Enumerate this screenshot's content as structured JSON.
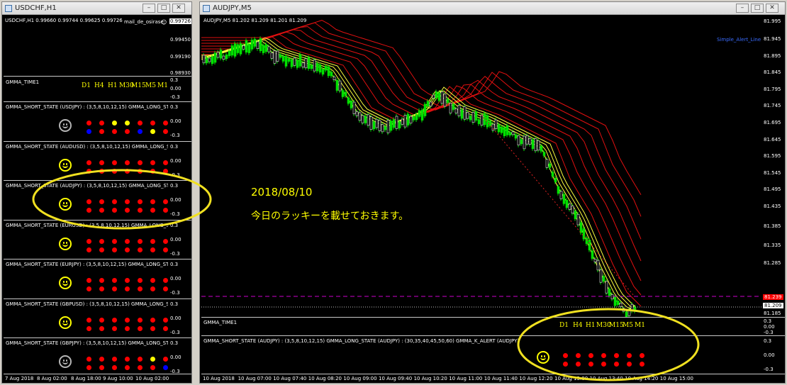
{
  "left_window": {
    "title": "USDCHF,H1",
    "chart_header": "USDCHF,H1  0.99660 0.99744 0.99625 0.99726",
    "indicator_label": "mail_de_osirase",
    "price_ticks": [
      "0.99726",
      "0.99450",
      "0.99190",
      "0.98930"
    ],
    "time_pane": {
      "title": "GMMA_TIME1",
      "frames": [
        "D1",
        "H4",
        "H1",
        "M30",
        "M15",
        "M5",
        "M1"
      ],
      "ticks": [
        "0.3",
        "0.00",
        "-0.3"
      ]
    },
    "state_panes": [
      {
        "title": "GMMA_SHORT_STATE (USDJPY) : (3,5,8,10,12,15)  GMMA_LONG_STA",
        "smiley": "gray",
        "ticks": [
          "0.3",
          "0.00",
          "-0.3"
        ],
        "row1": [
          "#ff0000",
          "#ff0000",
          "#ffff00",
          "#ffff00",
          "#ff0000",
          "#ff0000",
          "#ff0000"
        ],
        "row2": [
          "#0000ff",
          "#ff0000",
          "#ff0000",
          "#ff0000",
          "#0000ff",
          "#ffff00",
          "#ff0000"
        ]
      },
      {
        "title": "GMMA_SHORT_STATE (AUDUSD) : (3,5,8,10,12,15)  GMMA_LONG_STA",
        "smiley": "yellow",
        "ticks": [
          "0.3",
          "0.00",
          "-0.3"
        ],
        "row1": [
          "#ff0000",
          "#ff0000",
          "#ff0000",
          "#ff0000",
          "#ff0000",
          "#ff0000",
          "#ff0000"
        ],
        "row2": [
          "#ff0000",
          "#ff0000",
          "#ff0000",
          "#ff0000",
          "#ff0000",
          "#ff0000",
          "#ff0000"
        ]
      },
      {
        "title": "GMMA_SHORT_STATE (AUDJPY) : (3,5,8,10,12,15)  GMMA_LONG_STA",
        "smiley": "yellow",
        "ticks": [
          "0.3",
          "0.00",
          "-0.3"
        ],
        "row1": [
          "#ff0000",
          "#ff0000",
          "#ff0000",
          "#ff0000",
          "#ff0000",
          "#ff0000",
          "#ff0000"
        ],
        "row2": [
          "#ff0000",
          "#ff0000",
          "#ff0000",
          "#ff0000",
          "#ff0000",
          "#ff0000",
          "#ff0000"
        ]
      },
      {
        "title": "GMMA_SHORT_STATE (EURUSD) : (3,5,8,10,12,15)  GMMA_LONG_STA",
        "smiley": "yellow",
        "ticks": [
          "0.3",
          "0.00",
          "-0.3"
        ],
        "row1": [
          "#ff0000",
          "#ff0000",
          "#ff0000",
          "#ff0000",
          "#ff0000",
          "#ff0000",
          "#ff0000"
        ],
        "row2": [
          "#ff0000",
          "#ff0000",
          "#ff0000",
          "#ff0000",
          "#ff0000",
          "#ff0000",
          "#ff0000"
        ]
      },
      {
        "title": "GMMA_SHORT_STATE (EURJPY) : (3,5,8,10,12,15)  GMMA_LONG_STA",
        "smiley": "yellow",
        "ticks": [
          "0.3",
          "0.00",
          "-0.3"
        ],
        "row1": [
          "#ff0000",
          "#ff0000",
          "#ff0000",
          "#ff0000",
          "#ff0000",
          "#ff0000",
          "#ff0000"
        ],
        "row2": [
          "#ff0000",
          "#ff0000",
          "#ff0000",
          "#ff0000",
          "#ff0000",
          "#ff0000",
          "#ff0000"
        ]
      },
      {
        "title": "GMMA_SHORT_STATE (GBPUSD) : (3,5,8,10,12,15)  GMMA_LONG_STA",
        "smiley": "yellow",
        "ticks": [
          "0.3",
          "0.00",
          "-0.3"
        ],
        "row1": [
          "#ff0000",
          "#ff0000",
          "#ff0000",
          "#ff0000",
          "#ff0000",
          "#ff0000",
          "#ff0000"
        ],
        "row2": [
          "#ff0000",
          "#ff0000",
          "#ff0000",
          "#ff0000",
          "#ff0000",
          "#ff0000",
          "#ff0000"
        ]
      },
      {
        "title": "GMMA_SHORT_STATE (GBPJPY) : (3,5,8,10,12,15)  GMMA_LONG_STA",
        "smiley": "gray",
        "ticks": [
          "0.3",
          "0.00",
          "-0.3"
        ],
        "row1": [
          "#ff0000",
          "#ff0000",
          "#ff0000",
          "#ff0000",
          "#ff0000",
          "#ffff00",
          "#ff0000"
        ],
        "row2": [
          "#ff0000",
          "#ff0000",
          "#ff0000",
          "#ff0000",
          "#ff0000",
          "#ff0000",
          "#0000ff"
        ]
      }
    ],
    "time_axis": [
      "7 Aug 2018",
      "8 Aug 02:00",
      "8 Aug 18:00",
      "9 Aug 10:00",
      "10 Aug 02:00"
    ]
  },
  "right_window": {
    "title": "AUDJPY,M5",
    "chart_header": "AUDJPY,M5  81.202 81.209 81.201 81.209",
    "alert_label": "Simple_Alert_Line",
    "overlay_date": "2018/08/10",
    "overlay_text": "今日のラッキーを載せておきます。",
    "price_ticks": [
      "81.995",
      "81.945",
      "81.895",
      "81.845",
      "81.795",
      "81.745",
      "81.695",
      "81.645",
      "81.595",
      "81.545",
      "81.495",
      "81.435",
      "81.385",
      "81.335",
      "81.285",
      "81.209",
      "81.185"
    ],
    "alert_price": "81.239",
    "current_price": "81.209",
    "time_pane": {
      "title": "GMMA_TIME1",
      "frames": [
        "D1",
        "H4",
        "H1",
        "M30",
        "M15",
        "M5",
        "M1"
      ],
      "ticks": [
        "0.3",
        "0.00",
        "-0.3"
      ]
    },
    "state_pane": {
      "title": "GMMA_SHORT_STATE (AUDJPY) : (3,5,8,10,12,15)  GMMA_LONG_STATE (AUDJPY) : (30,35,40,45,50,60)  GMMA_K_ALERT (AUDJPY)",
      "smiley": "yellow",
      "ticks": [
        "0.3",
        "0.00",
        "-0.3"
      ]
    },
    "time_axis": [
      "10 Aug 2018",
      "10 Aug 07:00",
      "10 Aug 07:40",
      "10 Aug 08:20",
      "10 Aug 09:00",
      "10 Aug 09:40",
      "10 Aug 10:20",
      "10 Aug 11:00",
      "10 Aug 11:40",
      "10 Aug 12:20",
      "10 Aug 13:00",
      "10 Aug 13:40",
      "10 Aug 14:20",
      "10 Aug 15:00"
    ]
  },
  "colors": {
    "yellow": "#ffff00",
    "red": "#ff0000",
    "blue": "#0000ff",
    "green": "#00ff00",
    "magenta": "#cc00cc",
    "highlight": "#f0e020"
  }
}
